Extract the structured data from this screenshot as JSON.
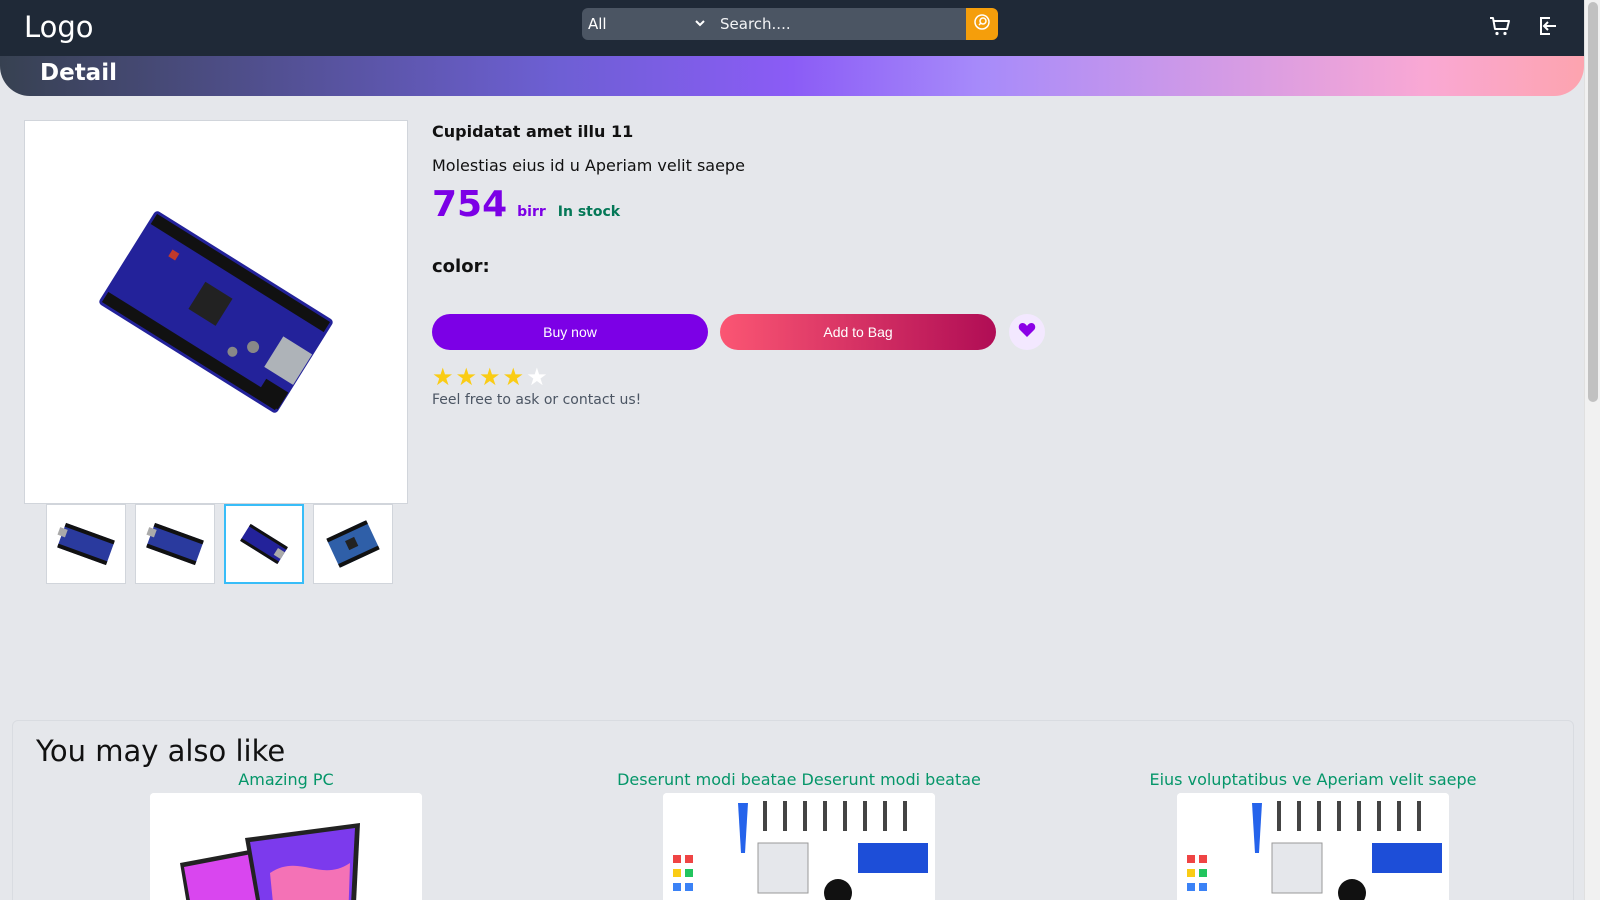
{
  "header": {
    "logo": "Logo",
    "category": "All",
    "search_placeholder": "Search...."
  },
  "banner": {
    "title": "Detail"
  },
  "product": {
    "title": "Cupidatat amet illu 11",
    "description": "Molestias eius id u Aperiam velit saepe",
    "price": "754",
    "currency": "birr",
    "stock": "In stock",
    "color_label": "color:",
    "buy_label": "Buy now",
    "bag_label": "Add to Bag",
    "rating": 4,
    "rating_max": 5,
    "contact": "Feel free to ask or contact us!"
  },
  "gallery": {
    "selected_thumbnail": 3,
    "thumbnail_count": 4
  },
  "colors": {
    "primary": "#7c00e6",
    "search_button": "#f59e0b",
    "stock": "#047857",
    "recommend_link": "#059669"
  },
  "recommendations": {
    "title": "You may also like",
    "items": [
      {
        "name": "Amazing PC"
      },
      {
        "name": "Deserunt modi beatae Deserunt modi beatae"
      },
      {
        "name": "Eius voluptatibus ve Aperiam velit saepe"
      }
    ]
  }
}
